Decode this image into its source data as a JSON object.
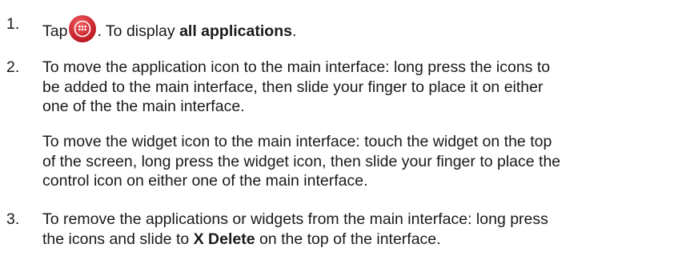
{
  "steps": [
    {
      "number": "1.",
      "text_before": "Tap",
      "icon": "all-apps-icon",
      "text_after": ". To display ",
      "bold": "all applications",
      "end": "."
    },
    {
      "number": "2.",
      "lines": [
        "To move the application icon to the main interface: long press the icons to",
        "be added to the main interface, then slide your finger to place it on either",
        "one of the the main interface."
      ],
      "extra_lines": [
        "To move the widget icon to the main interface: touch the widget on the top",
        "of the screen, long press the widget icon, then slide your finger to place the",
        "control icon on either one of the main interface."
      ]
    },
    {
      "number": "3.",
      "line1": "To remove the applications or widgets from the main interface: long press",
      "line2_before": "the icons and slide to ",
      "line2_bold": "X Delete",
      "line2_after": " on the top of the interface."
    }
  ],
  "colors": {
    "icon_red": "#d9232e",
    "icon_dot": "#ffffff"
  }
}
